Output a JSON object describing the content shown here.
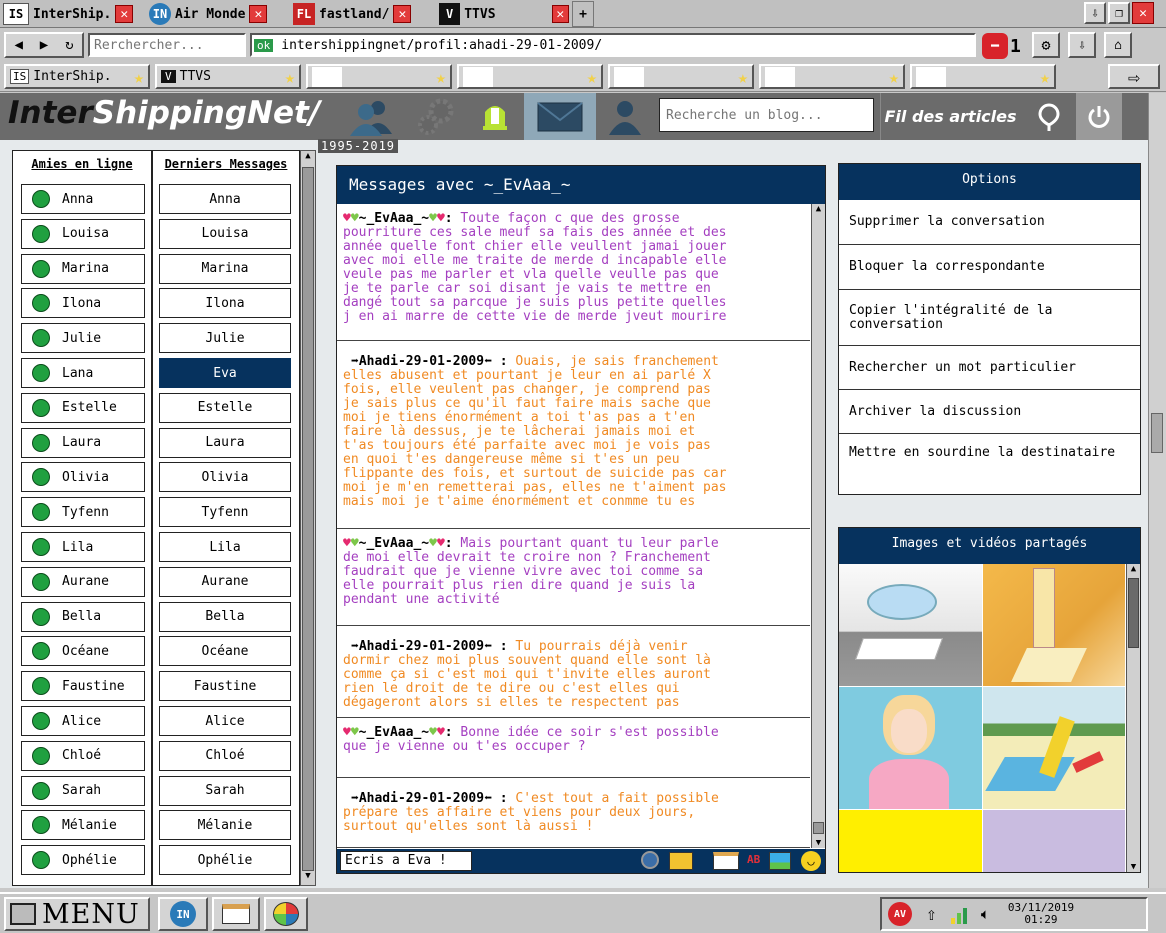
{
  "browser": {
    "tabs": [
      {
        "favicon": "IS",
        "title": "InterShip."
      },
      {
        "favicon": "IN",
        "title": "Air Monde"
      },
      {
        "favicon": "FL",
        "title": "fastland/"
      },
      {
        "favicon": "V",
        "title": "TTVS"
      }
    ],
    "new_tab_label": "+",
    "search_placeholder": "Rerchercher...",
    "ok_badge": "ok",
    "url": "intershippingnet/profil:ahadi-29-01-2009/",
    "stop_count": "1",
    "bookmarks": [
      {
        "favicon": "IS",
        "title": "InterShip."
      },
      {
        "favicon": "V",
        "title": "TTVS"
      }
    ]
  },
  "site": {
    "logo_dark": "Inter",
    "logo_light": "ShippingNet/",
    "years": "1995-2019",
    "search_placeholder": "Recherche un blog...",
    "feed_label": "Fil des articles"
  },
  "friends": {
    "online_header": "Amies en ligne",
    "messages_header": "Derniers Messages",
    "online": [
      "Anna",
      "Louisa",
      "Marina",
      "Ilona",
      "Julie",
      "Lana",
      "Estelle",
      "Laura",
      "Olivia",
      "Tyfenn",
      "Lila",
      "Aurane",
      "Bella",
      "Océane",
      "Faustine",
      "Alice",
      "Chloé",
      "Sarah",
      "Mélanie",
      "Ophélie"
    ],
    "messages": [
      "Anna",
      "Louisa",
      "Marina",
      "Ilona",
      "Julie",
      "Eva",
      "Estelle",
      "Laura",
      "Olivia",
      "Tyfenn",
      "Lila",
      "Aurane",
      "Bella",
      "Océane",
      "Faustine",
      "Alice",
      "Chloé",
      "Sarah",
      "Mélanie",
      "Ophélie"
    ],
    "selected_index": 5
  },
  "chat": {
    "title": "Messages avec ~_EvAaa_~",
    "her_name": "~_EvAaa_~",
    "my_name": "Ahadi-29-01-2009",
    "messages": [
      {
        "from": "her",
        "lines": [
          "Toute façon c que des grosse",
          "pourriture ces sale meuf sa fais des année et des",
          "année quelle font chier elle veullent jamai jouer",
          "avec moi elle me traite de merde d incapable elle",
          "veule pas me parler et vla quelle veulle pas que",
          "je te parle car soi disant je vais te mettre en",
          "dangé tout sa parcque je suis plus petite quelles",
          "j en ai marre de cette vie de merde jveut mourire"
        ]
      },
      {
        "from": "me",
        "lines": [
          "Ouais, je sais franchement",
          "elles abusent et pourtant je leur en ai parlé X",
          "fois, elle veulent pas changer, je comprend pas",
          "je sais plus ce qu'il faut faire mais sache que",
          "moi je tiens énormément a toi t'as pas a t'en",
          "faire là dessus, je te lâcherai jamais moi et",
          "t'as toujours été parfaite avec moi je vois pas",
          "en quoi t'es dangereuse même si t'es un peu",
          "flippante des fois, et surtout de suicide pas car",
          "moi je m'en remetterai pas, elles ne t'aiment pas",
          "mais moi je t'aime énormément et conmme tu es"
        ]
      },
      {
        "from": "her",
        "lines": [
          "Mais pourtant quant tu leur parle",
          "de moi elle devrait te croire non ? Franchement",
          "faudrait que je vienne vivre avec toi comme sa",
          "elle pourrait plus rien dire quand je suis la",
          "pendant une activité"
        ]
      },
      {
        "from": "me",
        "lines": [
          "Tu pourrais déjà venir",
          "dormir chez moi plus souvent quand elle sont là",
          "comme ça si c'est moi qui t'invite elles auront",
          "rien le droit de te dire ou c'est elles qui",
          "dégageront alors si elles te respectent pas"
        ]
      },
      {
        "from": "her",
        "lines": [
          "Bonne idée ce soir s'est possible",
          "que je vienne ou t'es occuper ?"
        ]
      },
      {
        "from": "me",
        "lines": [
          "C'est tout a fait possible",
          "prépare tes affaire et viens pour deux jours,",
          "surtout qu'elles sont là aussi !"
        ]
      }
    ],
    "input_value": "Ecris a Eva !",
    "ab_label": "AB"
  },
  "options": {
    "title": "Options",
    "items": [
      "Supprimer la conversation",
      "Bloquer la correspondante",
      "Copier l'intégralité de la conversation",
      "Rechercher un mot particulier",
      "Archiver la discussion",
      "Mettre en sourdine la destinataire"
    ]
  },
  "media": {
    "title": "Images et vidéos partagés"
  },
  "taskbar": {
    "menu_label": "MENU",
    "in_badge": "IN",
    "av_badge": "AV",
    "date": "03/11/2019",
    "time": "01:29"
  }
}
